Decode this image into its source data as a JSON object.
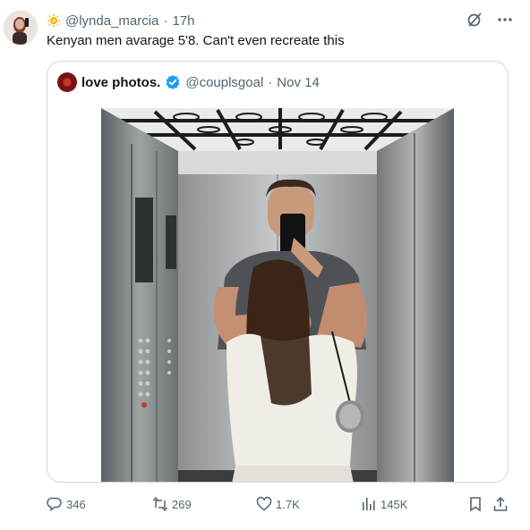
{
  "tweet": {
    "handle": "@lynda_marcia",
    "separator": "·",
    "time": "17h",
    "text": "Kenyan men avarage 5'8. Can't even recreate this"
  },
  "quote": {
    "name": "love photos.",
    "handle": "@couplsgoal",
    "separator": "·",
    "date": "Nov 14"
  },
  "actions": {
    "replies": "346",
    "retweets": "269",
    "likes": "1.7K",
    "views": "145K"
  },
  "colors": {
    "text": "#0f1419",
    "muted": "#536471",
    "verified": "#1d9bf0",
    "border": "#cfd9de"
  }
}
